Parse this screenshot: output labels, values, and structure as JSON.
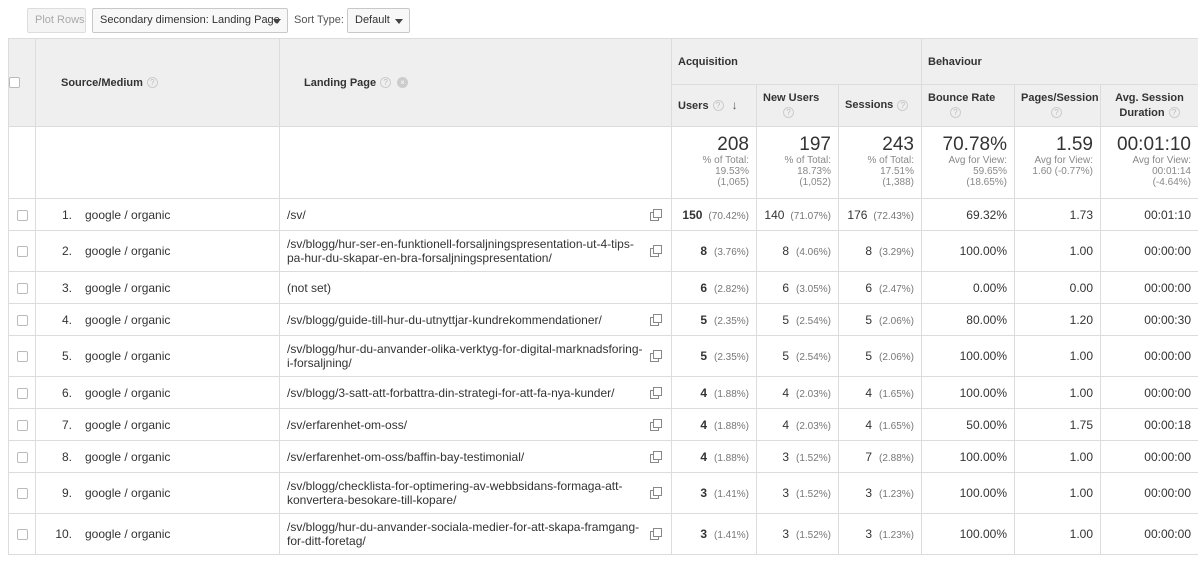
{
  "toolbar": {
    "plot_rows": "Plot Rows",
    "secondary_dimension": "Secondary dimension: Landing Page",
    "sort_type_label": "Sort Type:",
    "sort_type_value": "Default"
  },
  "header": {
    "source_medium": "Source/Medium",
    "landing_page": "Landing Page",
    "acquisition": "Acquisition",
    "behaviour": "Behaviour",
    "users": "Users",
    "new_users": "New Users",
    "sessions": "Sessions",
    "bounce_rate": "Bounce Rate",
    "pages_session": "Pages/Session",
    "avg_session_duration": "Avg. Session Duration",
    "help_glyph": "?",
    "remove_glyph": "×",
    "sort_glyph": "↓"
  },
  "totals": {
    "users": {
      "value": "208",
      "l1": "% of Total:",
      "l2": "19.53%",
      "l3": "(1,065)"
    },
    "new_users": {
      "value": "197",
      "l1": "% of Total:",
      "l2": "18.73%",
      "l3": "(1,052)"
    },
    "sessions": {
      "value": "243",
      "l1": "% of Total:",
      "l2": "17.51%",
      "l3": "(1,388)"
    },
    "bounce_rate": {
      "value": "70.78%",
      "l1": "Avg for View:",
      "l2": "59.65%",
      "l3": "(18.65%)"
    },
    "pages_session": {
      "value": "1.59",
      "l1": "Avg for View:",
      "l2": "1.60 (-0.77%)",
      "l3": ""
    },
    "avg_session_duration": {
      "value": "00:01:10",
      "l1": "Avg for View:",
      "l2": "00:01:14",
      "l3": "(-4.64%)"
    }
  },
  "rows": [
    {
      "index": "1.",
      "source": "google / organic",
      "landing": "/sv/",
      "link": true,
      "users": "150",
      "users_pct": "(70.42%)",
      "new_users": "140",
      "new_users_pct": "(71.07%)",
      "sessions": "176",
      "sessions_pct": "(72.43%)",
      "bounce": "69.32%",
      "pages": "1.73",
      "duration": "00:01:10"
    },
    {
      "index": "2.",
      "source": "google / organic",
      "landing": "/sv/blogg/hur-ser-en-funktionell-forsaljningspresentation-ut-4-tips-pa-hur-du-skapar-en-bra-forsaljningspresentation/",
      "link": true,
      "users": "8",
      "users_pct": "(3.76%)",
      "new_users": "8",
      "new_users_pct": "(4.06%)",
      "sessions": "8",
      "sessions_pct": "(3.29%)",
      "bounce": "100.00%",
      "pages": "1.00",
      "duration": "00:00:00"
    },
    {
      "index": "3.",
      "source": "google / organic",
      "landing": "(not set)",
      "link": false,
      "users": "6",
      "users_pct": "(2.82%)",
      "new_users": "6",
      "new_users_pct": "(3.05%)",
      "sessions": "6",
      "sessions_pct": "(2.47%)",
      "bounce": "0.00%",
      "pages": "0.00",
      "duration": "00:00:00"
    },
    {
      "index": "4.",
      "source": "google / organic",
      "landing": "/sv/blogg/guide-till-hur-du-utnyttjar-kundrekommendationer/",
      "link": true,
      "users": "5",
      "users_pct": "(2.35%)",
      "new_users": "5",
      "new_users_pct": "(2.54%)",
      "sessions": "5",
      "sessions_pct": "(2.06%)",
      "bounce": "80.00%",
      "pages": "1.20",
      "duration": "00:00:30"
    },
    {
      "index": "5.",
      "source": "google / organic",
      "landing": "/sv/blogg/hur-du-anvander-olika-verktyg-for-digital-marknadsforing-i-forsaljning/",
      "link": true,
      "users": "5",
      "users_pct": "(2.35%)",
      "new_users": "5",
      "new_users_pct": "(2.54%)",
      "sessions": "5",
      "sessions_pct": "(2.06%)",
      "bounce": "100.00%",
      "pages": "1.00",
      "duration": "00:00:00"
    },
    {
      "index": "6.",
      "source": "google / organic",
      "landing": "/sv/blogg/3-satt-att-forbattra-din-strategi-for-att-fa-nya-kunder/",
      "link": true,
      "users": "4",
      "users_pct": "(1.88%)",
      "new_users": "4",
      "new_users_pct": "(2.03%)",
      "sessions": "4",
      "sessions_pct": "(1.65%)",
      "bounce": "100.00%",
      "pages": "1.00",
      "duration": "00:00:00"
    },
    {
      "index": "7.",
      "source": "google / organic",
      "landing": "/sv/erfarenhet-om-oss/",
      "link": true,
      "users": "4",
      "users_pct": "(1.88%)",
      "new_users": "4",
      "new_users_pct": "(2.03%)",
      "sessions": "4",
      "sessions_pct": "(1.65%)",
      "bounce": "50.00%",
      "pages": "1.75",
      "duration": "00:00:18"
    },
    {
      "index": "8.",
      "source": "google / organic",
      "landing": "/sv/erfarenhet-om-oss/baffin-bay-testimonial/",
      "link": true,
      "users": "4",
      "users_pct": "(1.88%)",
      "new_users": "3",
      "new_users_pct": "(1.52%)",
      "sessions": "7",
      "sessions_pct": "(2.88%)",
      "bounce": "100.00%",
      "pages": "1.00",
      "duration": "00:00:00"
    },
    {
      "index": "9.",
      "source": "google / organic",
      "landing": "/sv/blogg/checklista-for-optimering-av-webbsidans-formaga-att-konvertera-besokare-till-kopare/",
      "link": true,
      "users": "3",
      "users_pct": "(1.41%)",
      "new_users": "3",
      "new_users_pct": "(1.52%)",
      "sessions": "3",
      "sessions_pct": "(1.23%)",
      "bounce": "100.00%",
      "pages": "1.00",
      "duration": "00:00:00"
    },
    {
      "index": "10.",
      "source": "google / organic",
      "landing": "/sv/blogg/hur-du-anvander-sociala-medier-for-att-skapa-framgang-for-ditt-foretag/",
      "link": true,
      "users": "3",
      "users_pct": "(1.41%)",
      "new_users": "3",
      "new_users_pct": "(1.52%)",
      "sessions": "3",
      "sessions_pct": "(1.23%)",
      "bounce": "100.00%",
      "pages": "1.00",
      "duration": "00:00:00"
    }
  ]
}
